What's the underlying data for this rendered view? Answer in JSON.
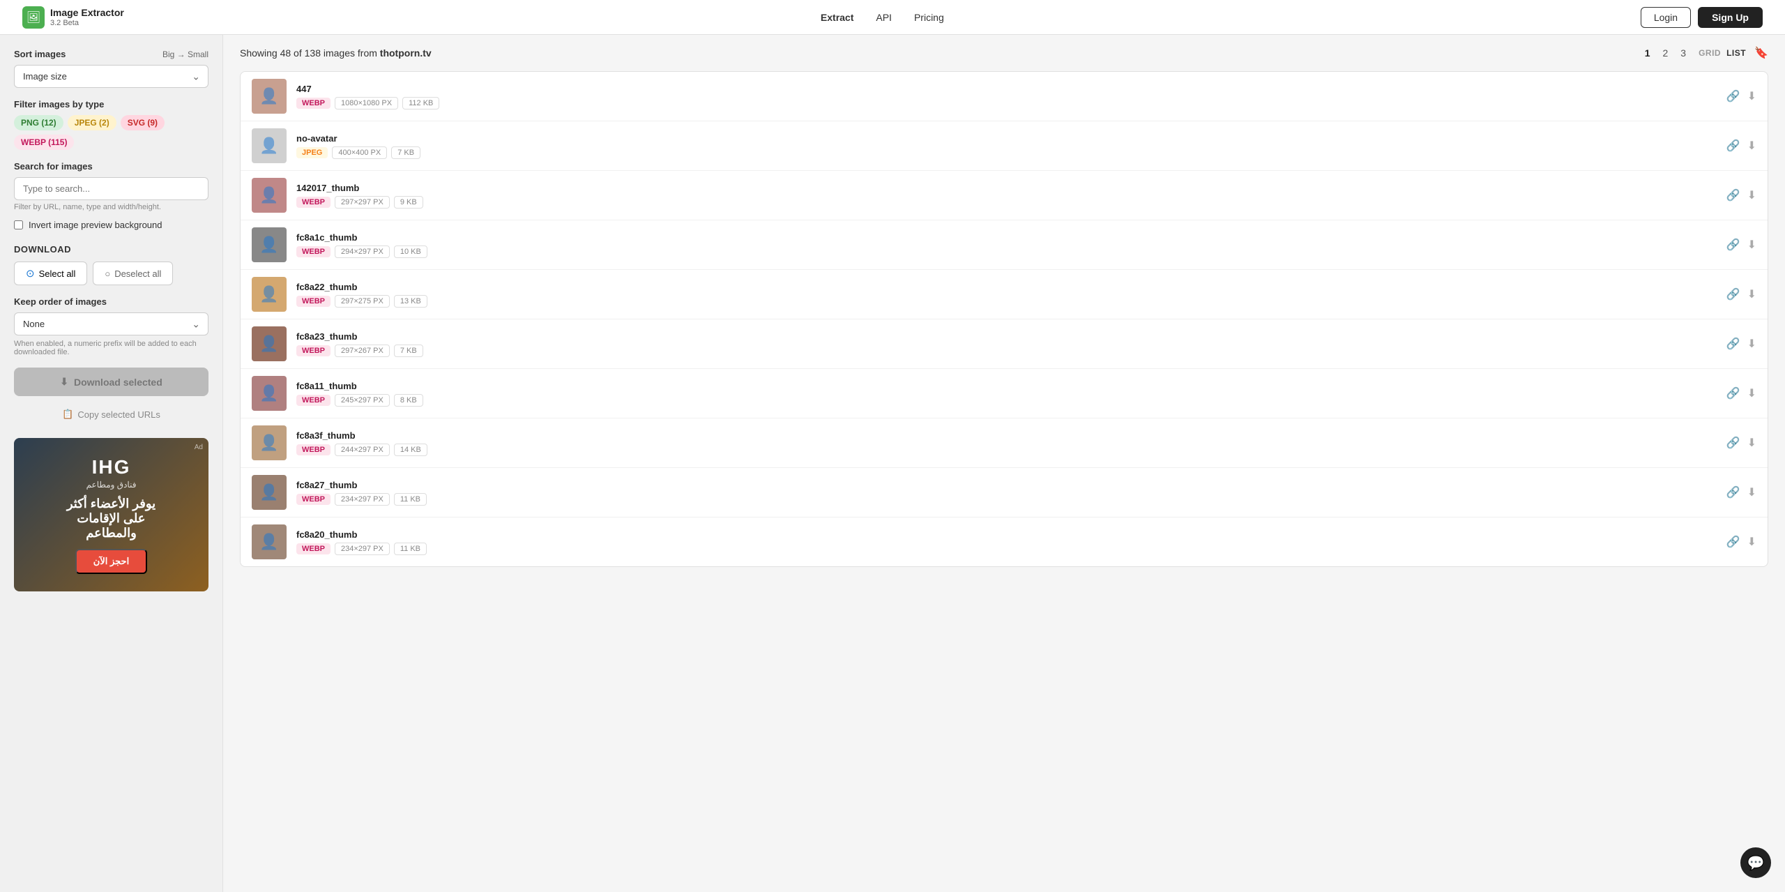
{
  "app": {
    "title": "Image Extractor",
    "version": "3.2 Beta",
    "logo_icon": "🖼"
  },
  "nav": {
    "items": [
      {
        "label": "Extract",
        "active": true
      },
      {
        "label": "API",
        "active": false
      },
      {
        "label": "Pricing",
        "active": false
      }
    ],
    "login_label": "Login",
    "signup_label": "Sign Up"
  },
  "sidebar": {
    "sort_label": "Sort images",
    "sort_dir": "Big → Small",
    "sort_option": "Image size",
    "filter_label": "Filter images by type",
    "filter_tags": [
      {
        "label": "PNG (12)",
        "type": "png"
      },
      {
        "label": "JPEG (2)",
        "type": "jpeg"
      },
      {
        "label": "SVG (9)",
        "type": "svg"
      },
      {
        "label": "WEBP (115)",
        "type": "webp"
      }
    ],
    "search_label": "Search for images",
    "search_placeholder": "Type to search...",
    "search_hint": "Filter by URL, name, type and width/height.",
    "invert_label": "Invert image preview background",
    "download_title": "DOWNLOAD",
    "select_all_label": "Select all",
    "deselect_all_label": "Deselect all",
    "keep_order_label": "Keep order of images",
    "keep_order_option": "None",
    "order_hint": "When enabled, a numeric prefix will be added to each downloaded file.",
    "download_btn": "Download selected",
    "copy_urls_btn": "Copy selected URLs"
  },
  "content": {
    "showing_text": "Showing 48 of 138 images from",
    "source_domain": "thotporn.tv",
    "pagination": [
      "1",
      "2",
      "3"
    ],
    "active_page": "1",
    "view_grid": "GRID",
    "view_list": "LIST",
    "images": [
      {
        "name": "447",
        "type": "WEBP",
        "type_key": "webp",
        "dimensions": "1080×1080 PX",
        "size": "112 KB",
        "thumb_color": "#c8a090",
        "thumb_char": "👤"
      },
      {
        "name": "no-avatar",
        "type": "JPEG",
        "type_key": "jpeg",
        "dimensions": "400×400 PX",
        "size": "7 KB",
        "thumb_color": "#d0d0d0",
        "thumb_char": "👤"
      },
      {
        "name": "142017_thumb",
        "type": "WEBP",
        "type_key": "webp",
        "dimensions": "297×297 PX",
        "size": "9 KB",
        "thumb_color": "#c08888",
        "thumb_char": "👤"
      },
      {
        "name": "fc8a1c_thumb",
        "type": "WEBP",
        "type_key": "webp",
        "dimensions": "294×297 PX",
        "size": "10 KB",
        "thumb_color": "#888888",
        "thumb_char": "👤"
      },
      {
        "name": "fc8a22_thumb",
        "type": "WEBP",
        "type_key": "webp",
        "dimensions": "297×275 PX",
        "size": "13 KB",
        "thumb_color": "#d4a870",
        "thumb_char": "👤"
      },
      {
        "name": "fc8a23_thumb",
        "type": "WEBP",
        "type_key": "webp",
        "dimensions": "297×267 PX",
        "size": "7 KB",
        "thumb_color": "#9a7060",
        "thumb_char": "👤"
      },
      {
        "name": "fc8a11_thumb",
        "type": "WEBP",
        "type_key": "webp",
        "dimensions": "245×297 PX",
        "size": "8 KB",
        "thumb_color": "#b08080",
        "thumb_char": "👤"
      },
      {
        "name": "fc8a3f_thumb",
        "type": "WEBP",
        "type_key": "webp",
        "dimensions": "244×297 PX",
        "size": "14 KB",
        "thumb_color": "#c0a080",
        "thumb_char": "👤"
      },
      {
        "name": "fc8a27_thumb",
        "type": "WEBP",
        "type_key": "webp",
        "dimensions": "234×297 PX",
        "size": "11 KB",
        "thumb_color": "#9a8070",
        "thumb_char": "👤"
      },
      {
        "name": "fc8a20_thumb",
        "type": "WEBP",
        "type_key": "webp",
        "dimensions": "234×297 PX",
        "size": "11 KB",
        "thumb_color": "#a08878",
        "thumb_char": "👤"
      }
    ]
  },
  "ad": {
    "brand": "IHG",
    "brand_sub": "فنادق ومطاعم",
    "text_line1": "يوفر الأعضاء أكثر",
    "text_line2": "على الإقامات",
    "text_line3": "والمطاعم",
    "cta": "احجز الآن",
    "ad_label": "Ad"
  },
  "icons": {
    "link": "🔗",
    "download": "⬇",
    "bookmark": "🔖",
    "chat": "💬",
    "download_btn": "⬇"
  }
}
